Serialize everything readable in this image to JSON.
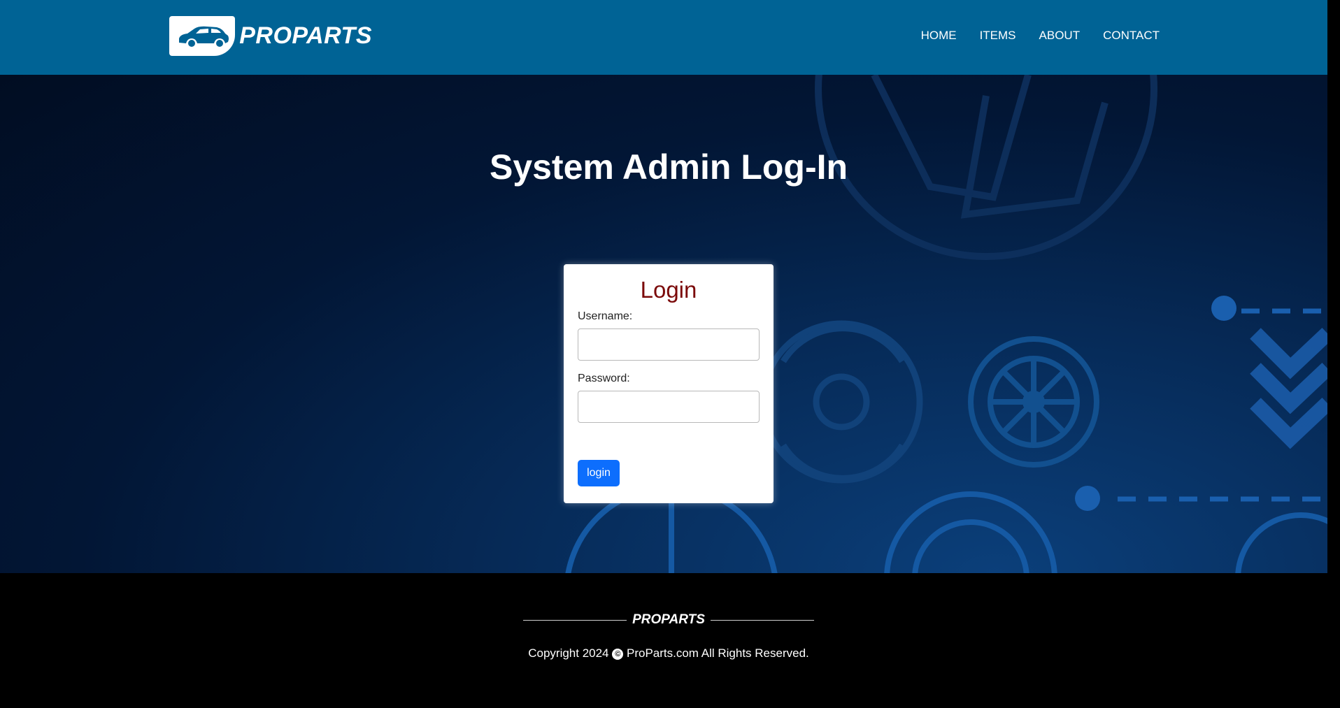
{
  "brand": {
    "name": "PROPARTS",
    "footer_name": "PROPARTS"
  },
  "nav": {
    "items": [
      "HOME",
      "ITEMS",
      "ABOUT",
      "CONTACT"
    ]
  },
  "hero": {
    "title": "System Admin Log-In"
  },
  "login": {
    "title": "Login",
    "username_label": "Username:",
    "username_value": "",
    "password_label": "Password:",
    "password_value": "",
    "button_label": "login"
  },
  "footer": {
    "copyright_prefix": "Copyright 2024",
    "copyright_icon": "©",
    "copyright_suffix": "ProParts.com All Rights Reserved."
  },
  "colors": {
    "header_bg": "#006395",
    "login_title": "#7b0a0a",
    "button_bg": "#0d6efd",
    "footer_bg": "#000000"
  }
}
